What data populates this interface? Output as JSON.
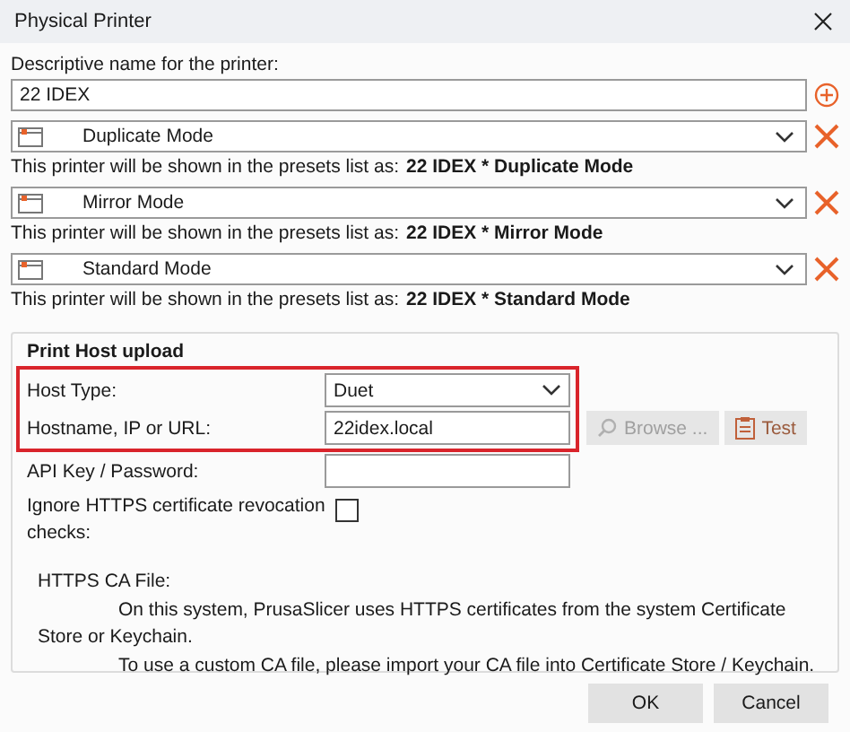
{
  "window": {
    "title": "Physical Printer"
  },
  "name_field": {
    "label": "Descriptive name for the printer:",
    "value": "22 IDEX"
  },
  "presets": [
    {
      "name": "Duplicate Mode",
      "note": "This printer will be shown in the presets list as:",
      "shown_as": "22 IDEX * Duplicate Mode"
    },
    {
      "name": "Mirror Mode",
      "note": "This printer will be shown in the presets list as:",
      "shown_as": "22 IDEX * Mirror Mode"
    },
    {
      "name": "Standard Mode",
      "note": "This printer will be shown in the presets list as:",
      "shown_as": "22 IDEX * Standard Mode"
    }
  ],
  "print_host": {
    "title": "Print Host upload",
    "rows": [
      {
        "kind": "combo",
        "label": "Host Type:",
        "value": "Duet",
        "highlighted": true
      },
      {
        "kind": "input",
        "label": "Hostname, IP or URL:",
        "value": "22idex.local",
        "highlighted": true,
        "buttons": [
          {
            "kind": "browse",
            "label": "Browse ...",
            "disabled": true
          },
          {
            "kind": "test",
            "label": "Test",
            "disabled": false
          }
        ]
      },
      {
        "kind": "input",
        "label": "API Key / Password:",
        "highlighted": false
      },
      {
        "kind": "checkbox",
        "label": "Ignore HTTPS certificate revocation checks:",
        "checked": false,
        "highlighted": false
      }
    ],
    "ca_file": {
      "label": "HTTPS CA File:",
      "paragraphs": [
        "On this system, PrusaSlicer uses HTTPS certificates from the system Certificate Store or Keychain.",
        "To use a custom CA file, please import your CA file into Certificate Store / Keychain."
      ]
    }
  },
  "buttons": [
    "OK",
    "Cancel"
  ]
}
